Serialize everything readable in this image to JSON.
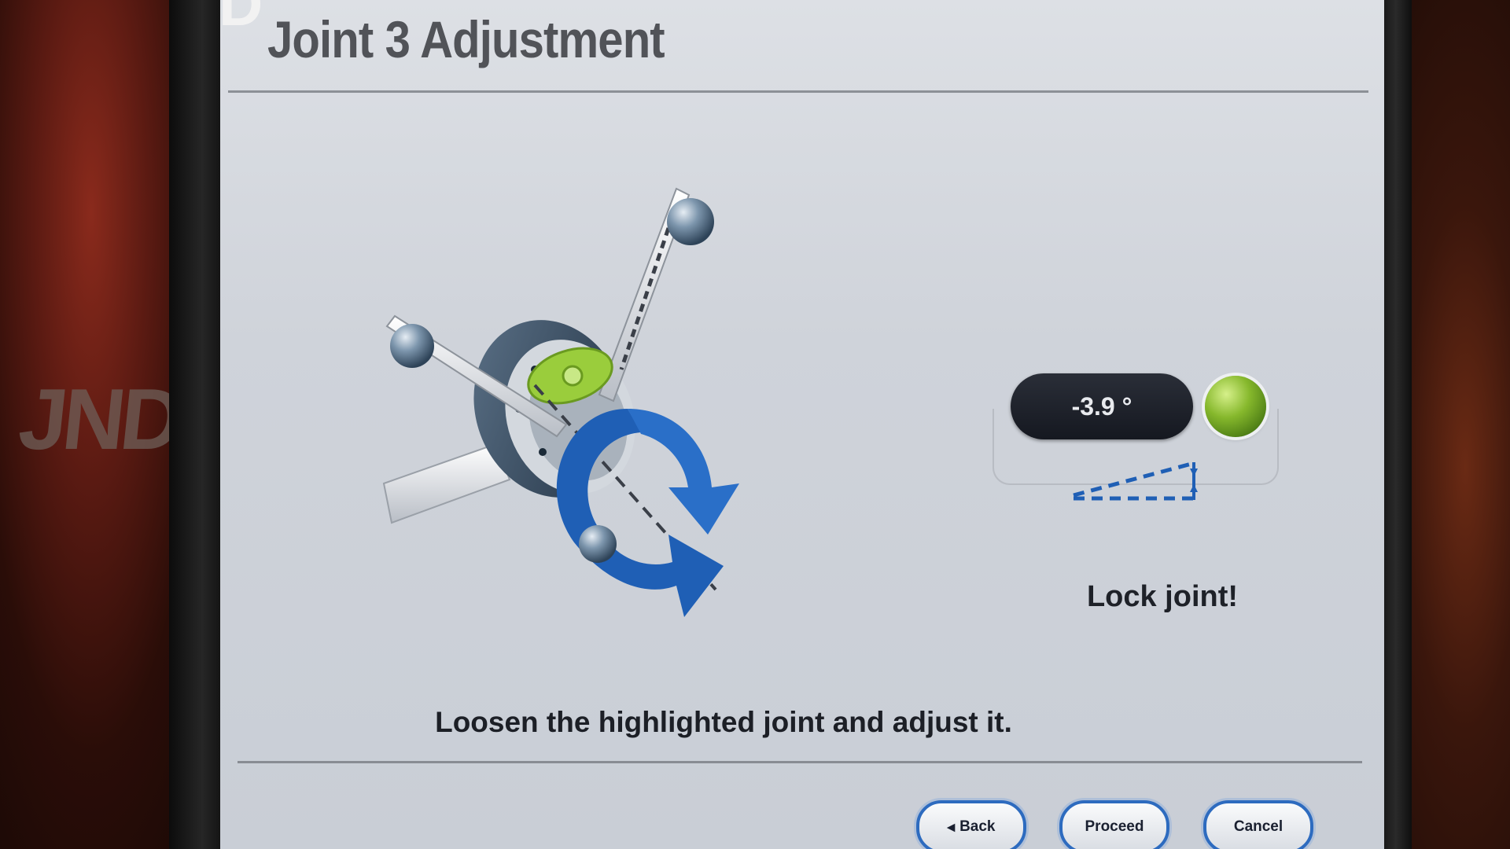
{
  "window": {
    "title": "Joint 3 Adjustment",
    "corner_mark": "D"
  },
  "background": {
    "graffiti_text": "JNDP"
  },
  "readout": {
    "angle": "-3.9 °",
    "status_color": "#86b82c"
  },
  "status": {
    "lock_message": "Lock joint!"
  },
  "instruction": {
    "text": "Loosen the highlighted joint and adjust it."
  },
  "buttons": {
    "back_label": "Back",
    "back_icon": "triangle-left-icon",
    "proceed_label": "Proceed",
    "cancel_label": "Cancel"
  },
  "colors": {
    "accent": "#2d6bbf",
    "highlight_joint": "#9acd3c",
    "rotation_arrow": "#1f5fb5"
  }
}
